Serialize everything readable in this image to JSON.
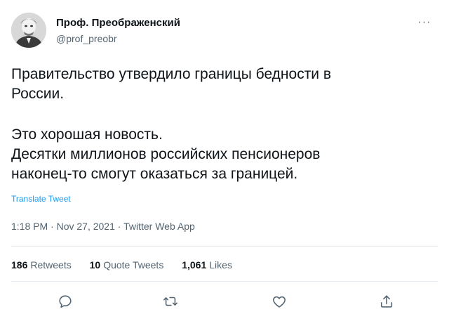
{
  "user": {
    "name": "Проф. Преображенский",
    "handle": "@prof_preobr"
  },
  "tweet": {
    "line1": "Правительство утвердило границы бедности в",
    "line2": "России.",
    "line3": "Это хорошая новость.",
    "line4": "Десятки миллионов российских пенсионеров",
    "line5": "наконец-то смогут оказаться за границей.",
    "translate_label": "Translate Tweet"
  },
  "meta": {
    "time": "1:18 PM",
    "date": "Nov 27, 2021",
    "source": "Twitter Web App",
    "separator": "·"
  },
  "stats": {
    "retweets_count": "186",
    "retweets_label": "Retweets",
    "quotes_count": "10",
    "quotes_label": "Quote Tweets",
    "likes_count": "1,061",
    "likes_label": "Likes"
  },
  "more_label": "···",
  "icons": {
    "reply": "reply-icon",
    "retweet": "retweet-icon",
    "like": "like-icon",
    "share": "share-icon",
    "more": "more-icon"
  },
  "colors": {
    "text": "#0f1419",
    "secondary": "#536471",
    "link": "#1d9bf0",
    "divider": "#e6ecf0"
  }
}
